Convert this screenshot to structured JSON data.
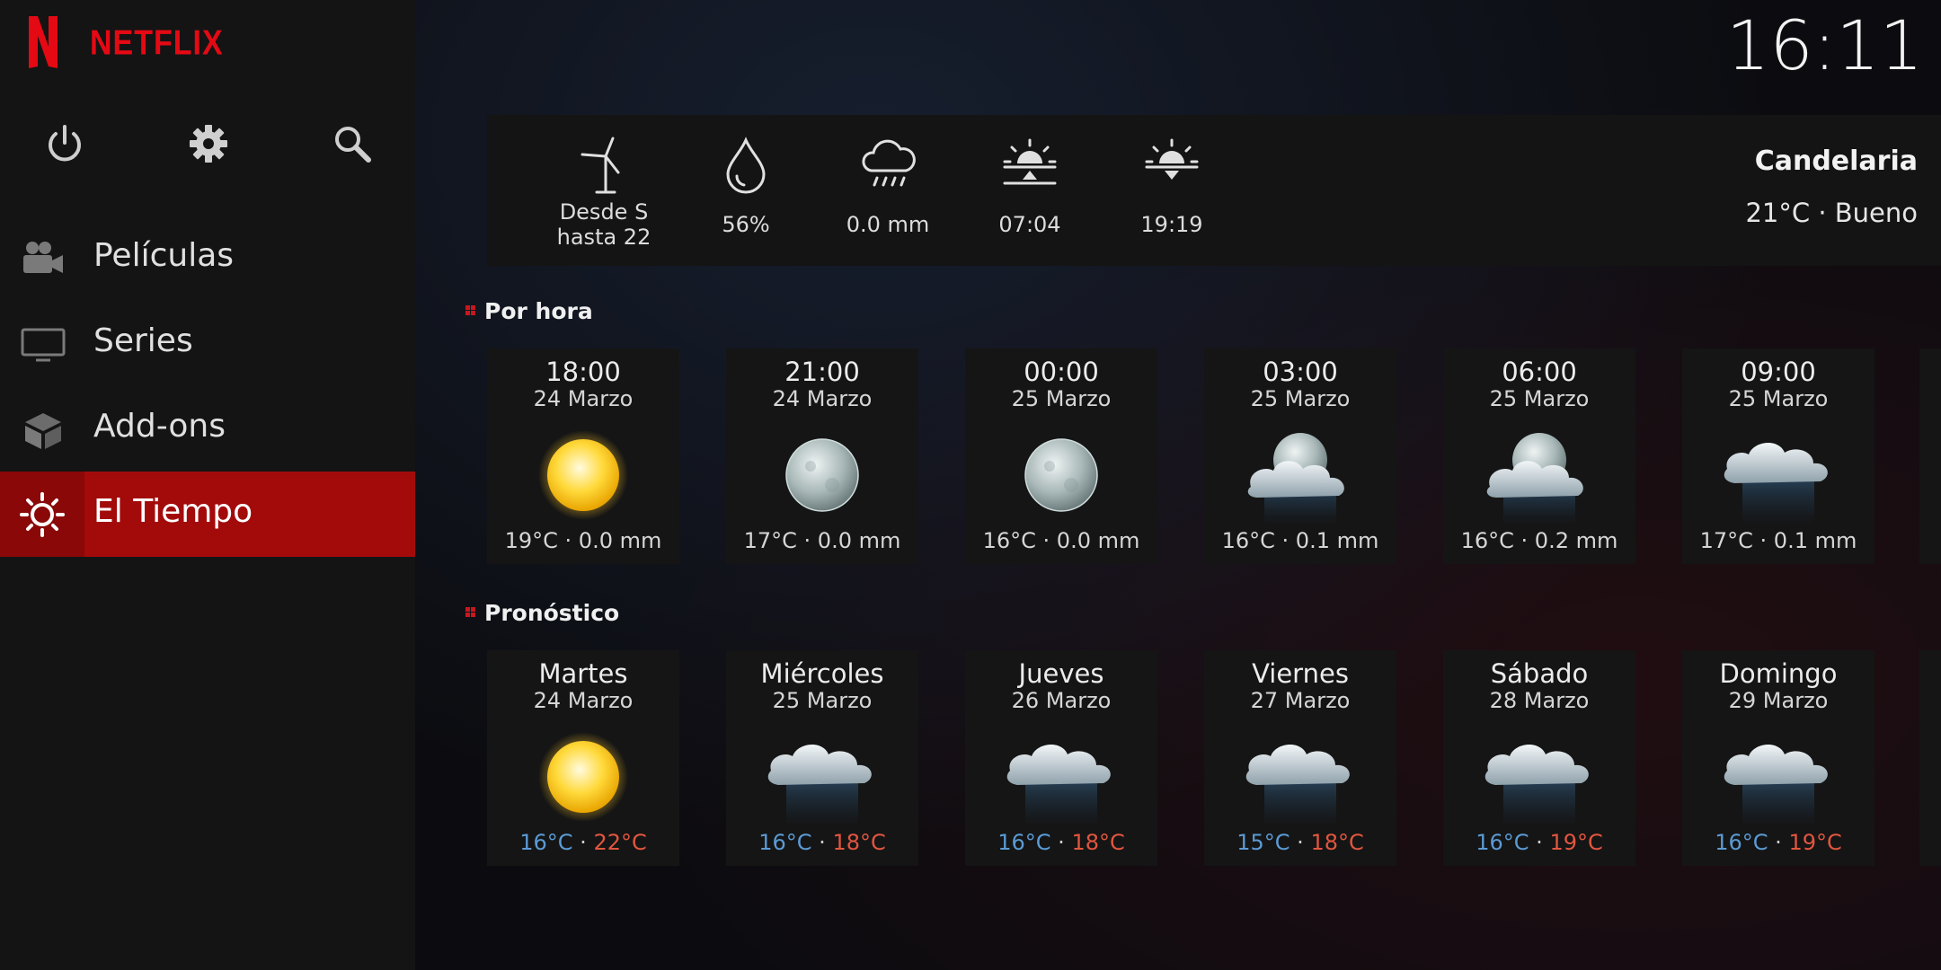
{
  "app": {
    "brand": "NETFLIX",
    "clock": "16:11"
  },
  "sidebar": {
    "system_icons": [
      "power-icon",
      "gear-icon",
      "search-icon"
    ],
    "items": [
      {
        "label": "Películas",
        "icon": "camera-icon"
      },
      {
        "label": "Series",
        "icon": "tv-icon"
      },
      {
        "label": "Add-ons",
        "icon": "box-icon"
      },
      {
        "label": "El Tiempo",
        "icon": "sun-icon",
        "active": true
      }
    ]
  },
  "current": {
    "wind": {
      "line1": "Desde S",
      "line2": "hasta 22"
    },
    "humidity": "56%",
    "precipitation": "0.0 mm",
    "sunrise": "07:04",
    "sunset": "19:19",
    "location": "Candelaria",
    "condition": "21°C · Bueno"
  },
  "hourly": {
    "title": "Por hora",
    "items": [
      {
        "time": "18:00",
        "date": "24 Marzo",
        "summary": "19°C · 0.0 mm",
        "icon": "sun"
      },
      {
        "time": "21:00",
        "date": "24 Marzo",
        "summary": "17°C · 0.0 mm",
        "icon": "moon"
      },
      {
        "time": "00:00",
        "date": "25 Marzo",
        "summary": "16°C · 0.0 mm",
        "icon": "moon"
      },
      {
        "time": "03:00",
        "date": "25 Marzo",
        "summary": "16°C · 0.1 mm",
        "icon": "moon-cloud-rain"
      },
      {
        "time": "06:00",
        "date": "25 Marzo",
        "summary": "16°C · 0.2 mm",
        "icon": "moon-cloud-rain"
      },
      {
        "time": "09:00",
        "date": "25 Marzo",
        "summary": "17°C · 0.1 mm",
        "icon": "cloud-rain"
      }
    ]
  },
  "forecast": {
    "title": "Pronóstico",
    "items": [
      {
        "day": "Martes",
        "date": "24 Marzo",
        "low": "16°C",
        "high": "22°C",
        "icon": "sun"
      },
      {
        "day": "Miércoles",
        "date": "25 Marzo",
        "low": "16°C",
        "high": "18°C",
        "icon": "cloud-rain"
      },
      {
        "day": "Jueves",
        "date": "26 Marzo",
        "low": "16°C",
        "high": "18°C",
        "icon": "cloud-rain"
      },
      {
        "day": "Viernes",
        "date": "27 Marzo",
        "low": "15°C",
        "high": "18°C",
        "icon": "cloud-rain"
      },
      {
        "day": "Sábado",
        "date": "28 Marzo",
        "low": "16°C",
        "high": "19°C",
        "icon": "cloud-rain"
      },
      {
        "day": "Domingo",
        "date": "29 Marzo",
        "low": "16°C",
        "high": "19°C",
        "icon": "cloud-rain"
      }
    ]
  },
  "colors": {
    "accent": "#a30b0b",
    "brand": "#e50914",
    "low": "#5b9bd5",
    "high": "#e2563f"
  }
}
